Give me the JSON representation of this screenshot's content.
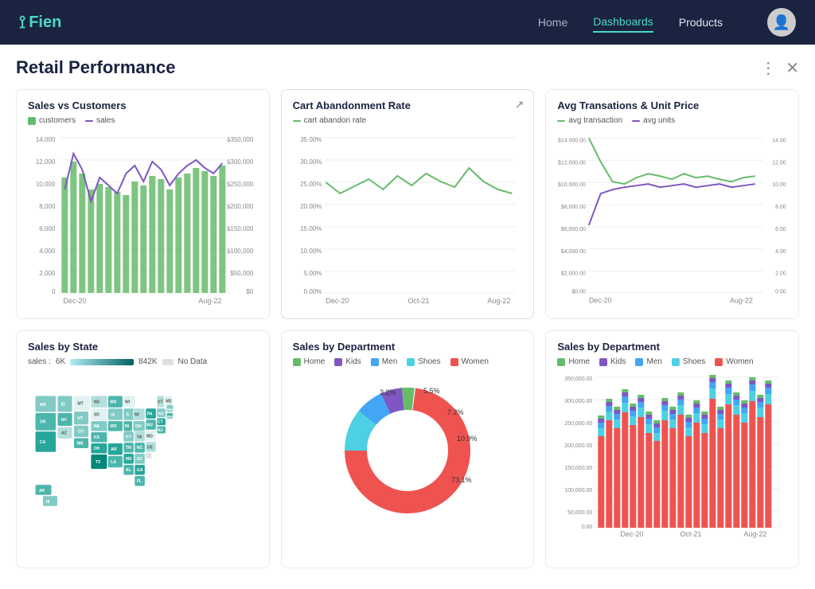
{
  "header": {
    "logo_text": "Fien",
    "nav": [
      {
        "label": "Home",
        "active": false
      },
      {
        "label": "Dashboards",
        "active": true
      },
      {
        "label": "Products",
        "active": false
      }
    ]
  },
  "page": {
    "title": "Retail Performance",
    "actions": [
      "more-icon",
      "close-icon"
    ]
  },
  "chart1": {
    "title": "Sales vs Customers",
    "legend": [
      {
        "label": "customers",
        "color": "#66bb6a",
        "type": "square"
      },
      {
        "label": "sales",
        "color": "#7e57c2",
        "type": "line"
      }
    ],
    "x_labels": [
      "Dec-20",
      "Aug-22"
    ],
    "y_left": [
      "0",
      "2,000",
      "4,000",
      "6,000",
      "8,000",
      "10,000",
      "12,000",
      "14,000"
    ],
    "y_right": [
      "$0",
      "$50,000",
      "$100,000",
      "$150,000",
      "$200,000",
      "$250,000",
      "$300,000",
      "$350,000"
    ]
  },
  "chart2": {
    "title": "Cart Abandonment Rate",
    "expand": "↗",
    "legend": [
      {
        "label": "cart abandon rate",
        "color": "#66bb6a",
        "type": "line"
      }
    ],
    "x_labels": [
      "Dec-20",
      "Oct-21",
      "Aug-22"
    ],
    "y_labels": [
      "0.00%",
      "5.00%",
      "10.00%",
      "15.00%",
      "20.00%",
      "25.00%",
      "30.00%",
      "35.00%"
    ]
  },
  "chart3": {
    "title": "Avg Transations & Unit Price",
    "legend": [
      {
        "label": "avg transaction",
        "color": "#66bb6a",
        "type": "line"
      },
      {
        "label": "avg units",
        "color": "#7e57c2",
        "type": "line"
      }
    ],
    "x_labels": [
      "Dec-20",
      "Aug-22"
    ],
    "y_left": [
      "$0.00",
      "$2,000.00",
      "$4,000.00",
      "$6,000.00",
      "$8,000.00",
      "$10,000.00",
      "$12,000.00",
      "$14,000.00"
    ],
    "y_right": [
      "0.00",
      "2.00",
      "4.00",
      "6.00",
      "8.00",
      "10.00",
      "12.00",
      "14.00"
    ]
  },
  "chart4": {
    "title": "Sales by State",
    "legend_min": "6K",
    "legend_max": "842K",
    "legend_nodata": "No Data"
  },
  "chart5": {
    "title": "Sales by Department",
    "legend": [
      {
        "label": "Home",
        "color": "#66bb6a"
      },
      {
        "label": "Kids",
        "color": "#7e57c2"
      },
      {
        "label": "Men",
        "color": "#42a5f5"
      },
      {
        "label": "Shoes",
        "color": "#4dd0e1"
      },
      {
        "label": "Women",
        "color": "#ef5350"
      }
    ],
    "segments": [
      {
        "label": "73.1%",
        "value": 73.1,
        "color": "#ef5350"
      },
      {
        "label": "10.9%",
        "value": 10.9,
        "color": "#4dd0e1"
      },
      {
        "label": "7.2%",
        "value": 7.2,
        "color": "#42a5f5"
      },
      {
        "label": "5.5%",
        "value": 5.5,
        "color": "#7e57c2"
      },
      {
        "label": "3.2%",
        "value": 3.2,
        "color": "#66bb6a"
      }
    ]
  },
  "chart6": {
    "title": "Sales by Department",
    "legend": [
      {
        "label": "Home",
        "color": "#66bb6a"
      },
      {
        "label": "Kids",
        "color": "#7e57c2"
      },
      {
        "label": "Men",
        "color": "#42a5f5"
      },
      {
        "label": "Shoes",
        "color": "#4dd0e1"
      },
      {
        "label": "Women",
        "color": "#ef5350"
      }
    ],
    "x_labels": [
      "Dec-20",
      "Oct-21",
      "Aug-22"
    ],
    "y_labels": [
      "0.00",
      "50,000.00",
      "100,000.00",
      "150,000.00",
      "200,000.00",
      "250,000.00",
      "300,000.00",
      "350,000.00"
    ]
  }
}
